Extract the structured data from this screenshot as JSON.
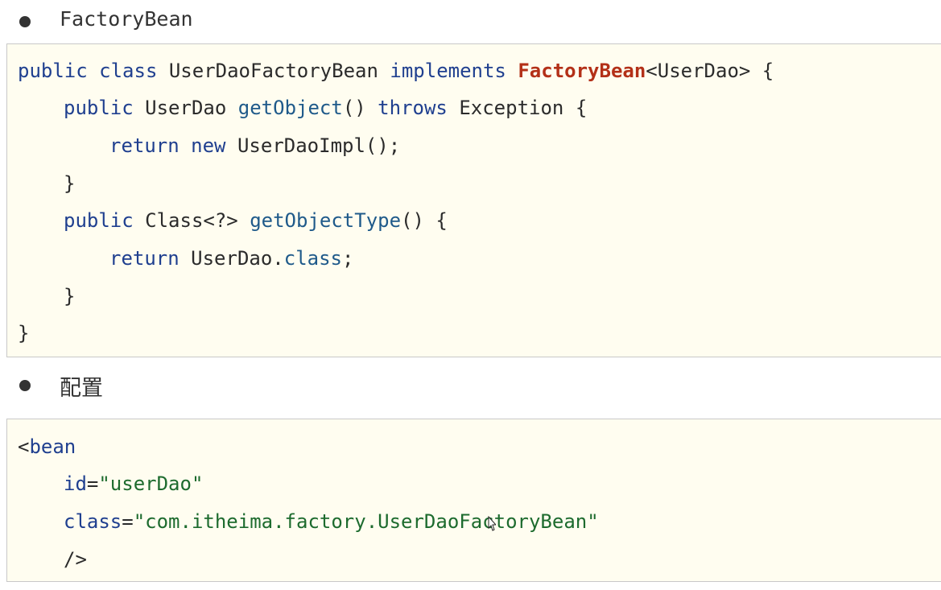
{
  "sections": [
    {
      "bullet": "FactoryBean",
      "code": {
        "line1": {
          "kw1": "public class",
          "name": "UserDaoFactoryBean",
          "kw2": "implements",
          "iface": "FactoryBean",
          "rest": "<UserDao> {"
        },
        "line2": {
          "kw": "public",
          "type": "UserDao",
          "fn": "getObject",
          "paren": "()",
          "throws": "throws",
          "rest": "Exception {"
        },
        "line3": {
          "kw1": "return",
          "kw2": "new",
          "rest": "UserDaoImpl();"
        },
        "line4": {
          "text": "}"
        },
        "line5": {
          "kw": "public",
          "type": "Class<?>",
          "fn": "getObjectType",
          "rest": "() {"
        },
        "line6": {
          "kw": "return",
          "type": "UserDao.",
          "cls": "class",
          "rest": ";"
        },
        "line7": {
          "text": "}"
        },
        "line8": {
          "text": "}"
        }
      }
    },
    {
      "bullet": "配置",
      "code": {
        "line1": {
          "lt": "<",
          "tag": "bean"
        },
        "line2": {
          "attr": "id",
          "eq": "=",
          "val": "\"userDao\""
        },
        "line3": {
          "attr": "class",
          "eq": "=",
          "val": "\"com.itheima.factory.UserDaoFactoryBean\""
        },
        "line4": {
          "text": "/>"
        }
      }
    }
  ],
  "colors": {
    "keyword": "#1f3f8f",
    "highlight_class": "#b33018",
    "string": "#1d6b2e",
    "code_background": "#fffdf0"
  },
  "icons": [
    "bullet-dot",
    "mouse-cursor-icon"
  ]
}
